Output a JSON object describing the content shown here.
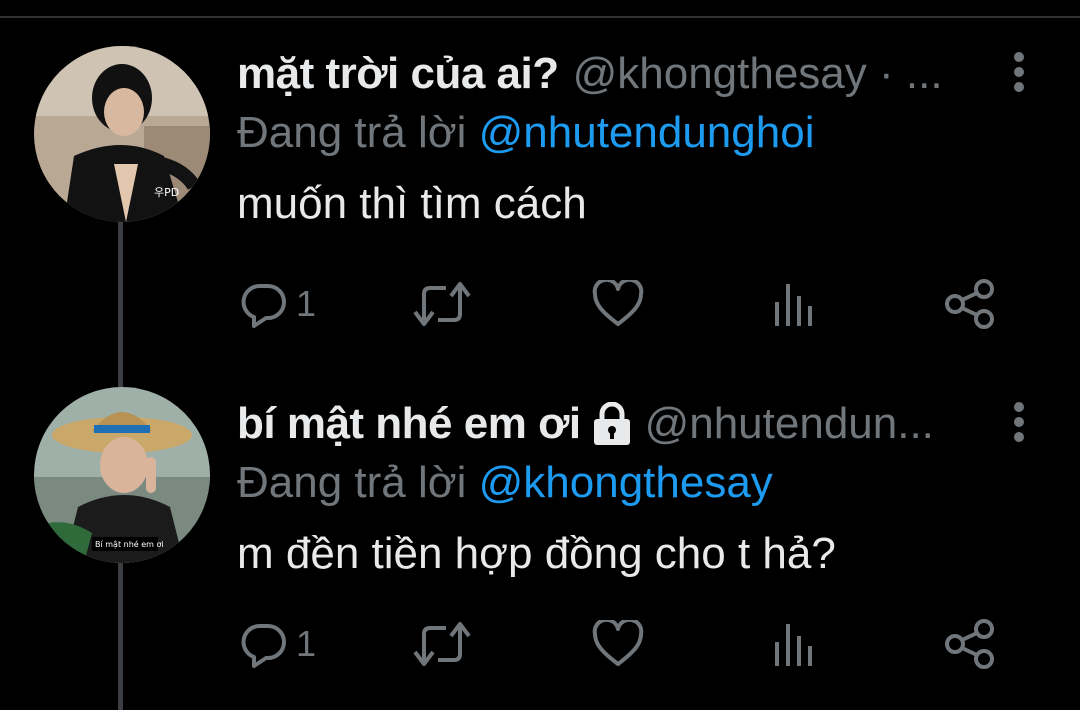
{
  "tweets": [
    {
      "name": "mặt trời của ai?",
      "handle": "@khongthesay · ...",
      "reply_prefix": "Đang trả lời",
      "reply_to": "@nhutendunghoi",
      "body": "muốn thì tìm cách",
      "avatar_caption": "우PD",
      "reply_count": "1",
      "locked": false
    },
    {
      "name": "bí mật nhé em ơi",
      "handle": "@nhutendun...",
      "reply_prefix": "Đang trả lời",
      "reply_to": "@khongthesay",
      "body": "m đền tiền hợp đồng cho t hả?",
      "avatar_caption": "Bí mật nhé em ơi",
      "reply_count": "1",
      "locked": true
    }
  ],
  "icons": {
    "more": "more-vertical-icon",
    "reply": "reply-icon",
    "retweet": "retweet-icon",
    "like": "heart-icon",
    "analytics": "analytics-icon",
    "share": "share-icon",
    "lock": "lock-icon"
  },
  "colors": {
    "background": "#000000",
    "text": "#e7e9ea",
    "secondary": "#71767b",
    "link": "#1d9bf0",
    "thread_line": "#3a3d41"
  }
}
